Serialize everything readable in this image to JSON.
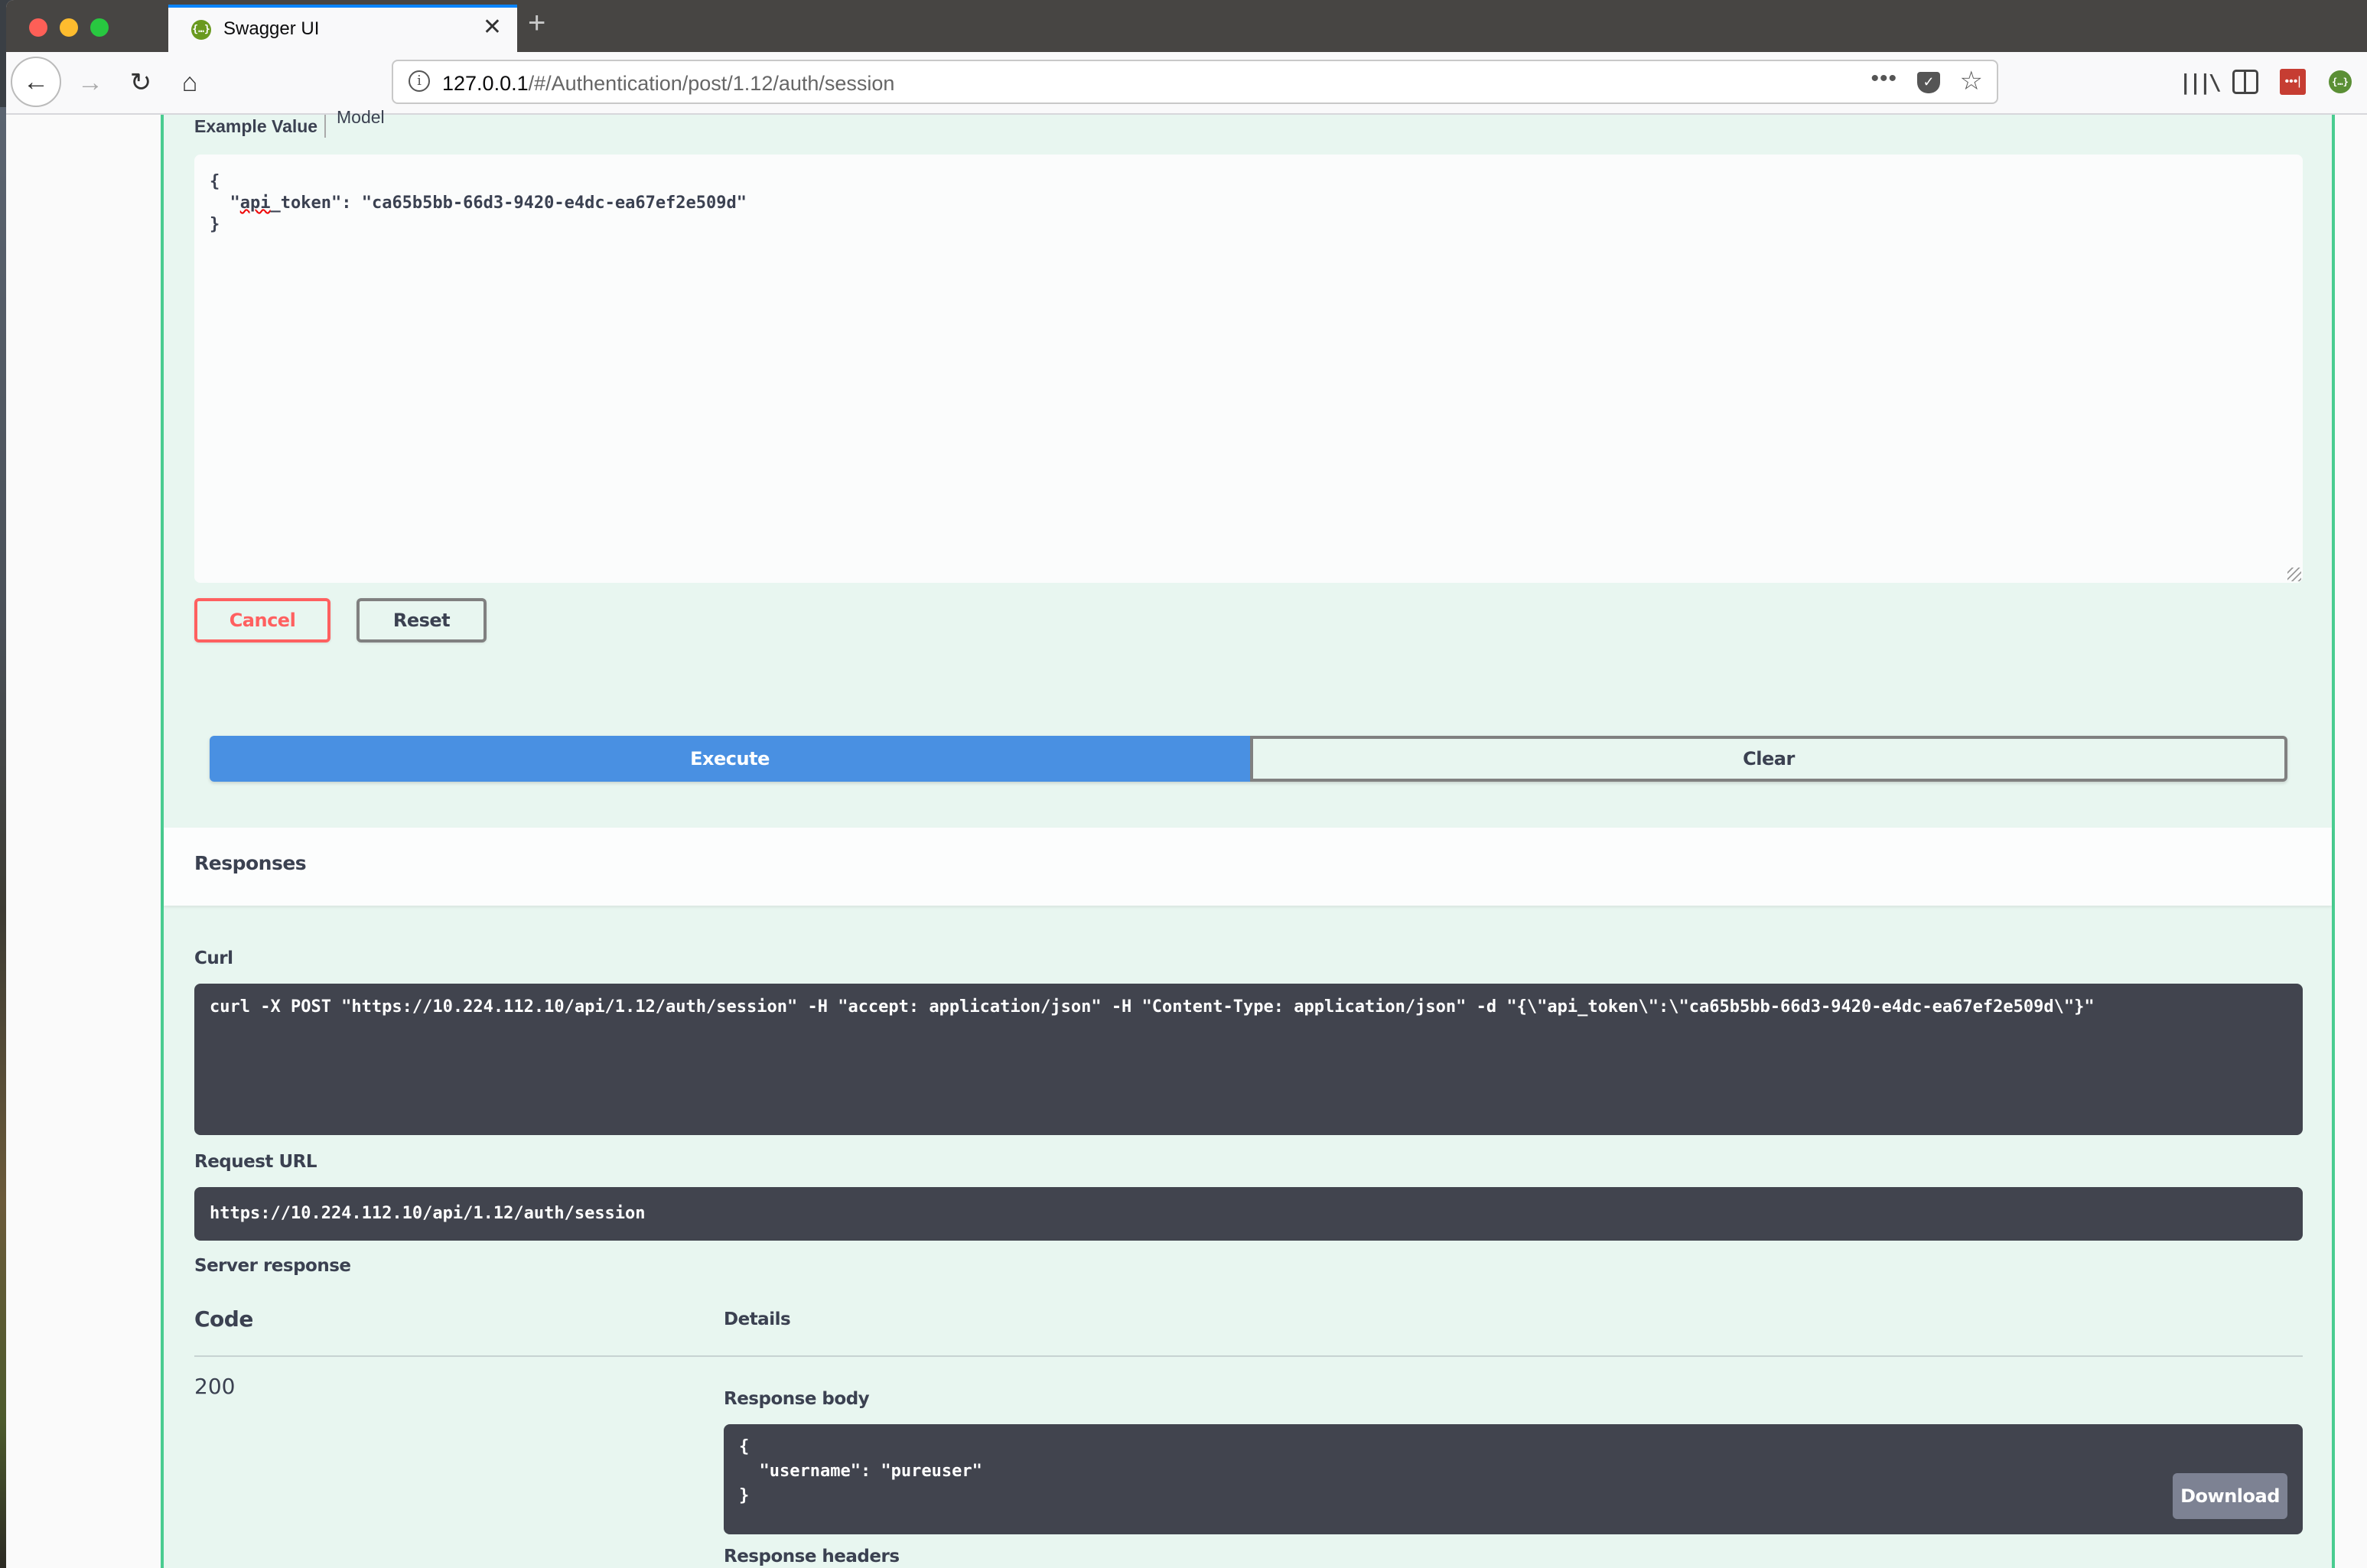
{
  "browser": {
    "tab_title": "Swagger UI",
    "tab_favicon": "{…}",
    "url_host": "127.0.0.1",
    "url_path": "/#/Authentication/post/1.12/auth/session",
    "more_glyph": "•••",
    "extension_glyph": "{…}",
    "lastpass_glyph": "•••|",
    "library_glyph": "|||\\"
  },
  "request": {
    "example_tab": "Example Value",
    "model_tab": "Model",
    "body_lines": {
      "open": "{",
      "key_prefix": "  \"",
      "key_squiggle": "api",
      "key_rest": "_token\": \"ca65b5bb-66d3-9420-e4dc-ea67ef2e509d\"",
      "close": "}"
    },
    "cancel_label": "Cancel",
    "reset_label": "Reset",
    "execute_label": "Execute",
    "clear_label": "Clear"
  },
  "responses": {
    "title": "Responses",
    "curl_label": "Curl",
    "curl_command": "curl -X POST \"https://10.224.112.10/api/1.12/auth/session\" -H \"accept: application/json\" -H \"Content-Type: application/json\" -d \"{\\\"api_token\\\":\\\"ca65b5bb-66d3-9420-e4dc-ea67ef2e509d\\\"}\"",
    "request_url_label": "Request URL",
    "request_url": "https://10.224.112.10/api/1.12/auth/session",
    "server_response_label": "Server response",
    "code_header": "Code",
    "details_header": "Details",
    "status_code": "200",
    "response_body_label": "Response body",
    "response_body": "{\n  \"username\": \"pureuser\"\n}",
    "download_label": "Download",
    "response_headers_label": "Response headers"
  },
  "colors": {
    "post_green": "#49cc90",
    "execute_blue": "#4990e2",
    "cancel_red": "#ff6060",
    "code_bg": "#41444e"
  }
}
